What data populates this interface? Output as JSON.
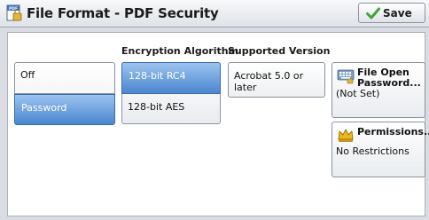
{
  "header": {
    "title": "File Format - PDF Security",
    "save_label": "Save",
    "icons": {
      "app": "pdf-document-icon",
      "save": "checkmark-icon"
    }
  },
  "security_method": {
    "options": [
      {
        "label": "Off",
        "selected": false
      },
      {
        "label": "Password",
        "selected": true
      }
    ]
  },
  "encryption": {
    "heading": "Encryption Algorithm",
    "options": [
      {
        "label": "128-bit RC4",
        "selected": true
      },
      {
        "label": "128-bit AES",
        "selected": false
      }
    ]
  },
  "supported_version": {
    "heading": "Supported Version",
    "value": "Acrobat 5.0 or later"
  },
  "file_open_password": {
    "line1": "File Open",
    "line2": "Password...",
    "value": "(Not Set)",
    "icon": "keyboard-icon"
  },
  "permissions": {
    "label": "Permissions...",
    "value": "No Restrictions",
    "icon": "crown-icon"
  },
  "colors": {
    "selected_top": "#9cc3f0",
    "selected_bottom": "#4a86cf",
    "panel_background": "#ffffff",
    "window_background": "#d9dde3"
  }
}
